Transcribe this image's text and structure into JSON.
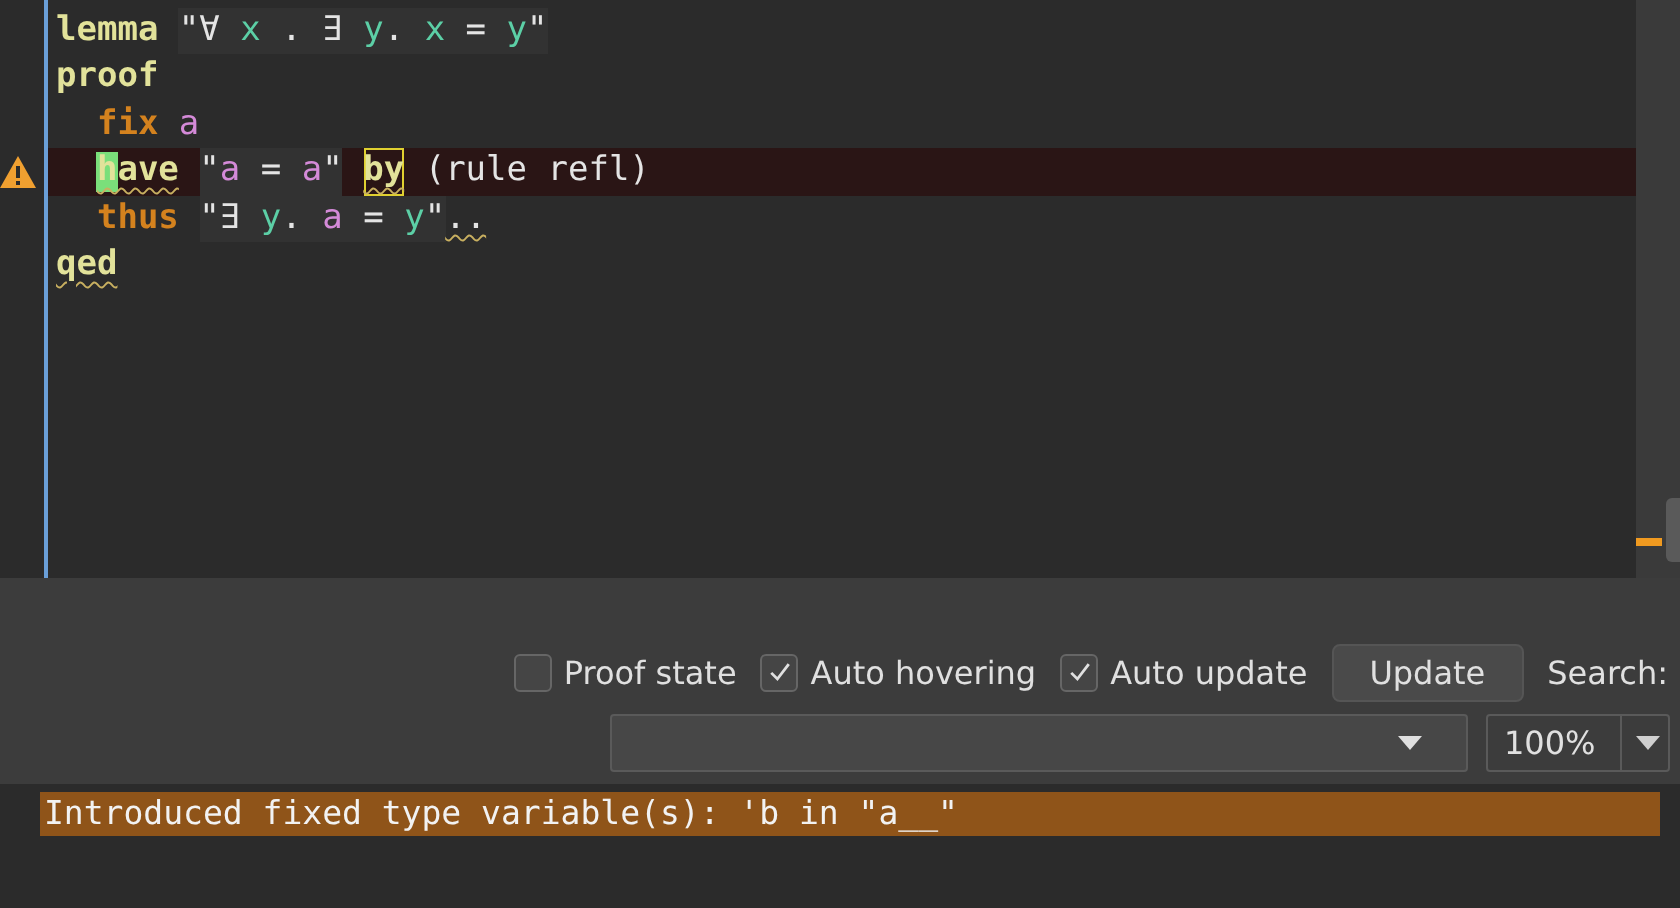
{
  "editor": {
    "lines": [
      {
        "warning": false,
        "segments": [
          {
            "kind": "command",
            "text": "lemma"
          },
          {
            "kind": "term",
            "tokens": [
              {
                "kind": "plain",
                "text": "\"∀ "
              },
              {
                "kind": "bound",
                "text": "x"
              },
              {
                "kind": "plain",
                "text": " . ∃ "
              },
              {
                "kind": "bound",
                "text": "y"
              },
              {
                "kind": "plain",
                "text": ". "
              },
              {
                "kind": "bound",
                "text": "x"
              },
              {
                "kind": "plain",
                "text": " = "
              },
              {
                "kind": "bound",
                "text": "y"
              },
              {
                "kind": "plain",
                "text": "\""
              }
            ]
          }
        ]
      },
      {
        "warning": false,
        "segments": [
          {
            "kind": "command",
            "text": "proof"
          }
        ],
        "children": [
          {
            "warning": false,
            "segments": [
              {
                "kind": "keyword",
                "text": "fix"
              },
              {
                "kind": "fixed",
                "text": "a"
              }
            ]
          },
          {
            "warning": true,
            "segments": [
              {
                "kind": "command",
                "text": "have",
                "cursor": true,
                "underline": true
              },
              {
                "kind": "term",
                "tokens": [
                  {
                    "kind": "plain",
                    "text": "\""
                  },
                  {
                    "kind": "fixed",
                    "text": "a"
                  },
                  {
                    "kind": "plain",
                    "text": " = "
                  },
                  {
                    "kind": "fixed",
                    "text": "a"
                  },
                  {
                    "kind": "plain",
                    "text": "\""
                  }
                ]
              },
              {
                "kind": "command",
                "text": "by",
                "boxed": true,
                "underline": true
              },
              {
                "kind": "plain",
                "text": "(rule refl)"
              }
            ]
          },
          {
            "warning": false,
            "segments": [
              {
                "kind": "keyword",
                "text": "thus"
              },
              {
                "kind": "term",
                "tokens": [
                  {
                    "kind": "plain",
                    "text": "\"∃ "
                  },
                  {
                    "kind": "bound",
                    "text": "y"
                  },
                  {
                    "kind": "plain",
                    "text": ". "
                  },
                  {
                    "kind": "fixed",
                    "text": "a"
                  },
                  {
                    "kind": "plain",
                    "text": " = "
                  },
                  {
                    "kind": "bound",
                    "text": "y"
                  },
                  {
                    "kind": "plain",
                    "text": "\""
                  }
                ]
              },
              {
                "kind": "plain",
                "text": "..",
                "underline": true,
                "attached": true
              }
            ]
          }
        ]
      },
      {
        "warning": false,
        "segments": [
          {
            "kind": "command",
            "text": "qed",
            "underline": true
          }
        ]
      }
    ]
  },
  "controls": {
    "checkboxes": [
      {
        "label": "Proof state",
        "checked": false
      },
      {
        "label": "Auto hovering",
        "checked": true
      },
      {
        "label": "Auto update",
        "checked": true
      }
    ],
    "update_button": "Update",
    "search_label": "Search:",
    "zoom": "100%"
  },
  "output": {
    "message": "Introduced fixed type variable(s): 'b in \"a__\""
  }
}
